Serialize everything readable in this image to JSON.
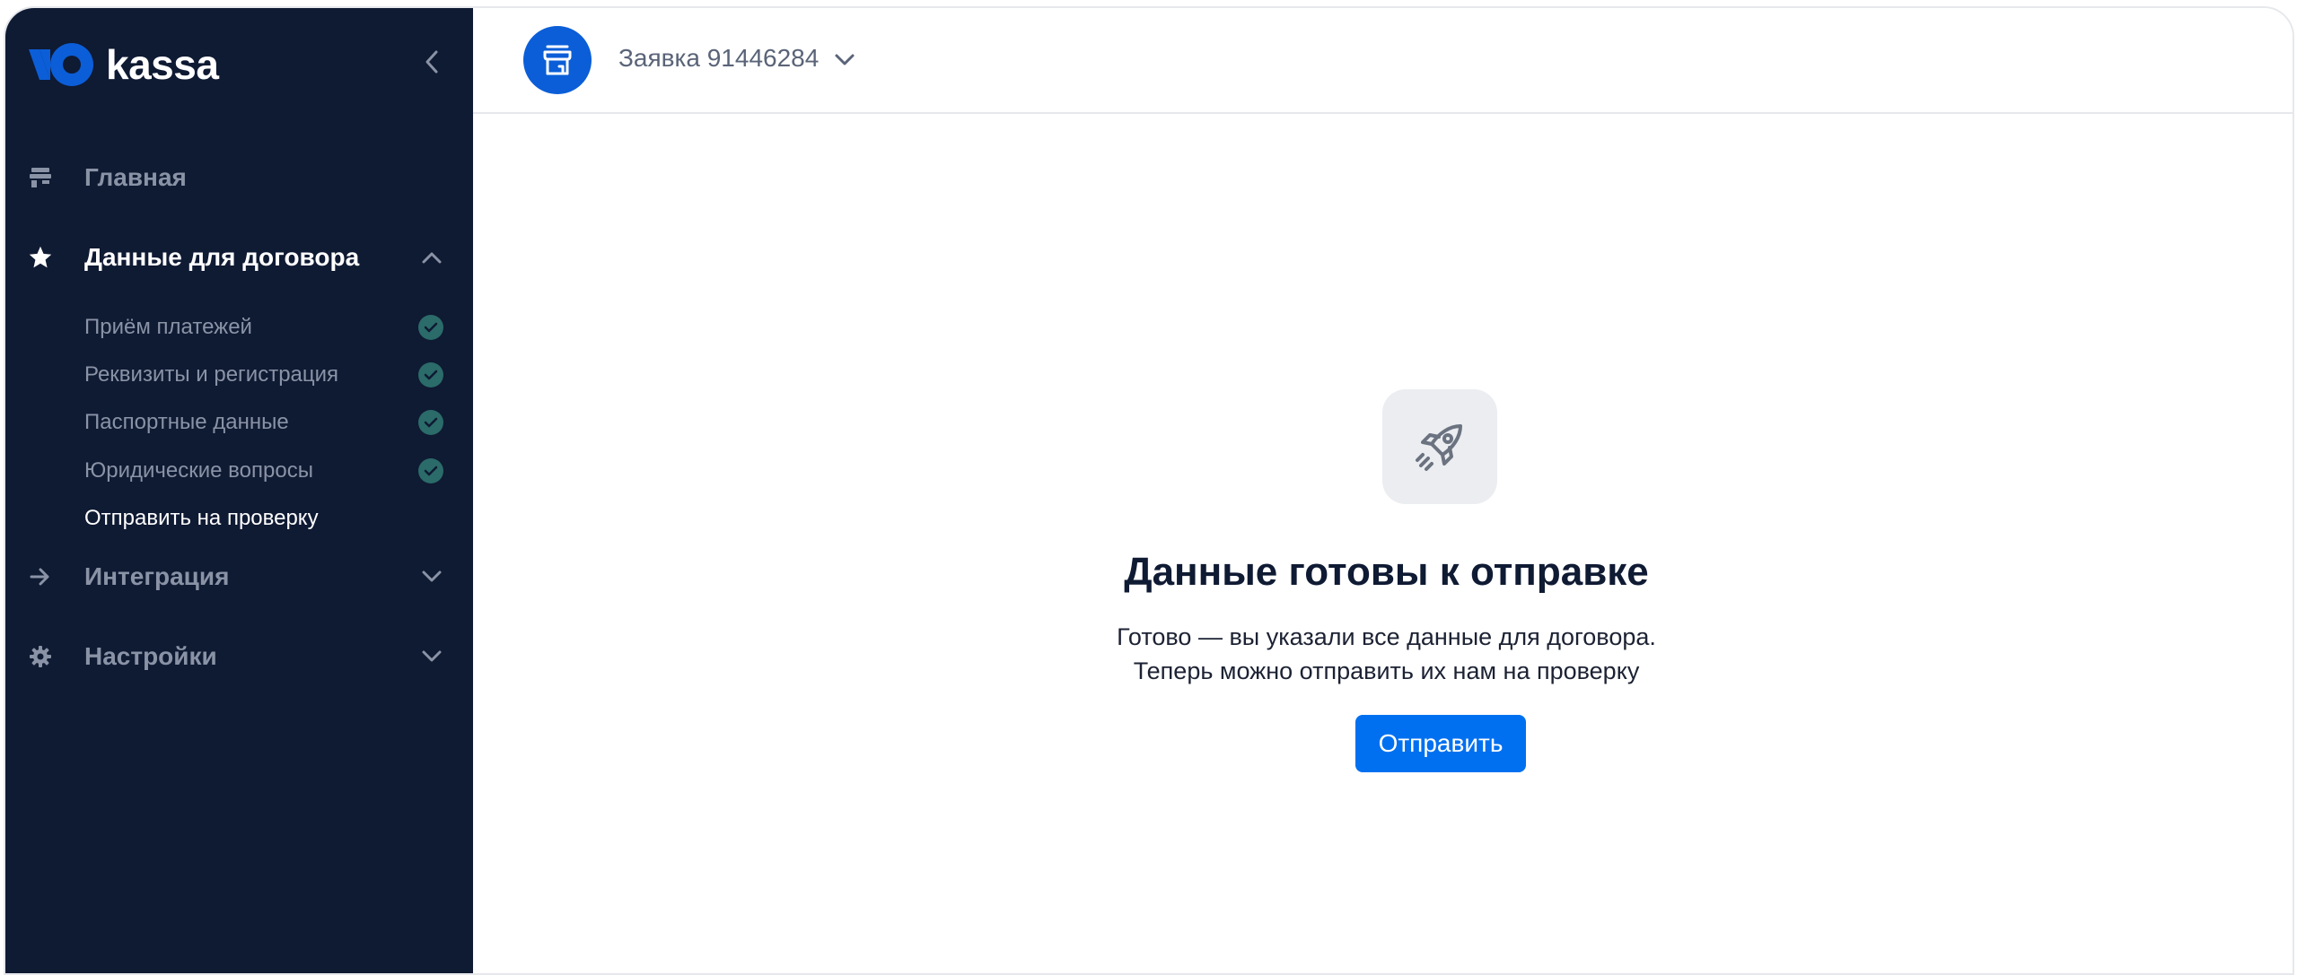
{
  "sidebar": {
    "logo": {
      "text": "kassa"
    },
    "nav": {
      "home": "Главная",
      "contract": "Данные для договора",
      "integration": "Интеграция",
      "settings": "Настройки"
    },
    "contract_steps": [
      {
        "label": "Приём платежей",
        "done": true
      },
      {
        "label": "Реквизиты и регистрация",
        "done": true
      },
      {
        "label": "Паспортные данные",
        "done": true
      },
      {
        "label": "Юридические вопросы",
        "done": true
      },
      {
        "label": "Отправить на проверку",
        "done": false
      }
    ]
  },
  "header": {
    "application_title": "Заявка 91446284"
  },
  "main": {
    "headline": "Данные готовы к отправке",
    "description_line1": "Готово — вы указали все данные для договора.",
    "description_line2": "Теперь можно отправить их нам на проверку",
    "submit_label": "Отправить"
  },
  "colors": {
    "sidebar_bg": "#0f1a33",
    "accent": "#0070f0",
    "badge": "#0b5ed7",
    "check": "#2b6b6a"
  }
}
